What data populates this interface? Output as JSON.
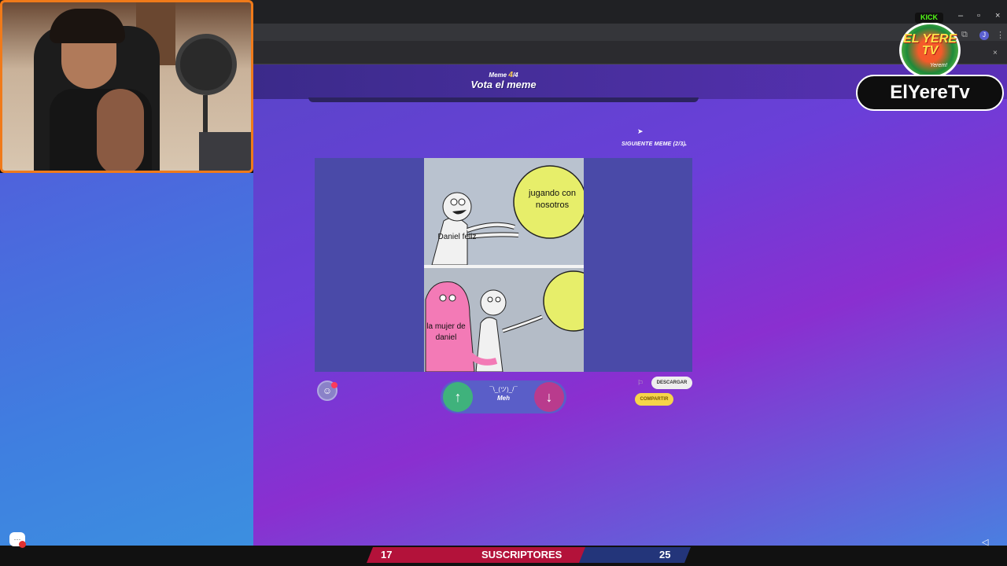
{
  "browser": {
    "window_controls": [
      "–",
      "▫",
      "×"
    ],
    "tab_close": "×",
    "profile_initial": "J"
  },
  "header": {
    "meme_prefix": "Meme",
    "meme_current": "4",
    "meme_total": "/4",
    "title": "Vota el meme"
  },
  "next": {
    "label": "SIGUIENTE MEME (2/3)",
    "arrow": "→"
  },
  "meme": {
    "top_bubble": "jugando con nosotros",
    "top_label": "Daniel feliz",
    "bottom_label": "la mujer de daniel",
    "colors": {
      "ball": "#e7ee6a",
      "pink": "#f37ab6",
      "char": "#f1f1f1"
    }
  },
  "controls": {
    "emoji": "☺",
    "up": "↑",
    "down": "↓",
    "meh_face": "¯\\_(ツ)_/¯",
    "meh_label": "Meh",
    "flag": "⚐",
    "download_label": "DESCARGAR",
    "share_label": "COMPARTIR"
  },
  "overlay": {
    "kick_label": "KICK",
    "logo_text": "EL YERE TV",
    "logo_sub": "Yerem!",
    "channel_name": "ElYereTv"
  },
  "subs": {
    "left_count": "17",
    "label": "SUSCRIPTORES",
    "right_count": "25"
  },
  "footer": {
    "chat_icon": "chat-icon",
    "volume_icon": "◁"
  },
  "colors": {
    "accent_orange": "#f07a1a",
    "kick_green": "#53fc18",
    "subs_red": "#b3123a",
    "subs_blue": "#23357a"
  }
}
